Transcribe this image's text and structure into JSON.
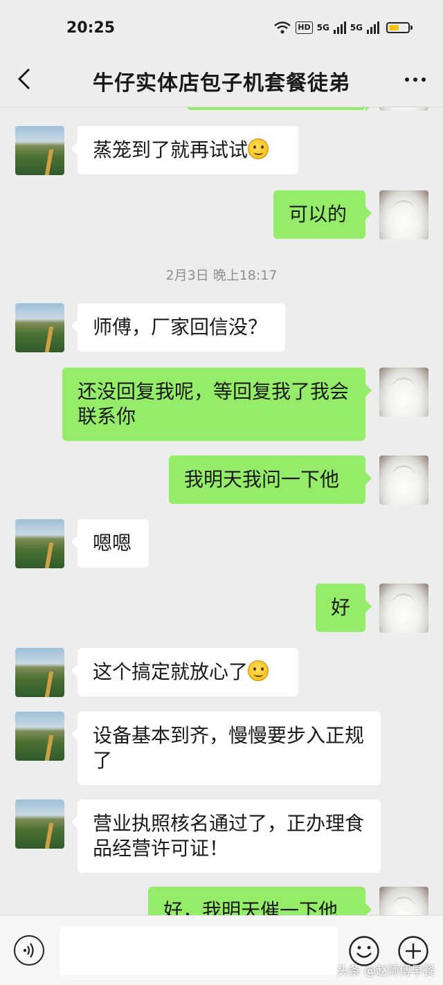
{
  "status_bar": {
    "time": "20:25",
    "hd_label": "HD",
    "network_1": "5G",
    "network_2": "5G",
    "battery_color": "#f5c21b"
  },
  "header": {
    "title": "牛仔实体店包子机套餐徒弟",
    "back_icon": "chevron-left-icon",
    "more_icon": "more-dots-icon"
  },
  "chat": {
    "timestamp": "2月3日 晚上18:17",
    "messages": [
      {
        "side": "left",
        "text": "蒸笼到了就再试试",
        "emoji": "smile-emoji"
      },
      {
        "side": "right",
        "text": "可以的"
      },
      {
        "side": "left",
        "text": "师傅，厂家回信没？"
      },
      {
        "side": "right",
        "text": "还没回复我呢，等回复我了我会联系你"
      },
      {
        "side": "right",
        "text": "我明天我问一下他"
      },
      {
        "side": "left",
        "text": "嗯嗯"
      },
      {
        "side": "right",
        "text": "好"
      },
      {
        "side": "left",
        "text": "这个搞定就放心了",
        "emoji": "smile-emoji"
      },
      {
        "side": "left",
        "text": "设备基本到齐，慢慢要步入正规了"
      },
      {
        "side": "left",
        "text": "营业执照核名通过了，正办理食品经营许可证！"
      },
      {
        "side": "right",
        "text": "好，我明天催一下他"
      }
    ],
    "colors": {
      "outgoing": "#95ec69",
      "incoming": "#ffffff",
      "background": "#ededed"
    }
  },
  "input_bar": {
    "voice_icon": "voice-icon",
    "emoji_icon": "emoji-icon",
    "plus_icon": "plus-icon"
  },
  "watermark": "头条 @赵师傅早餐"
}
